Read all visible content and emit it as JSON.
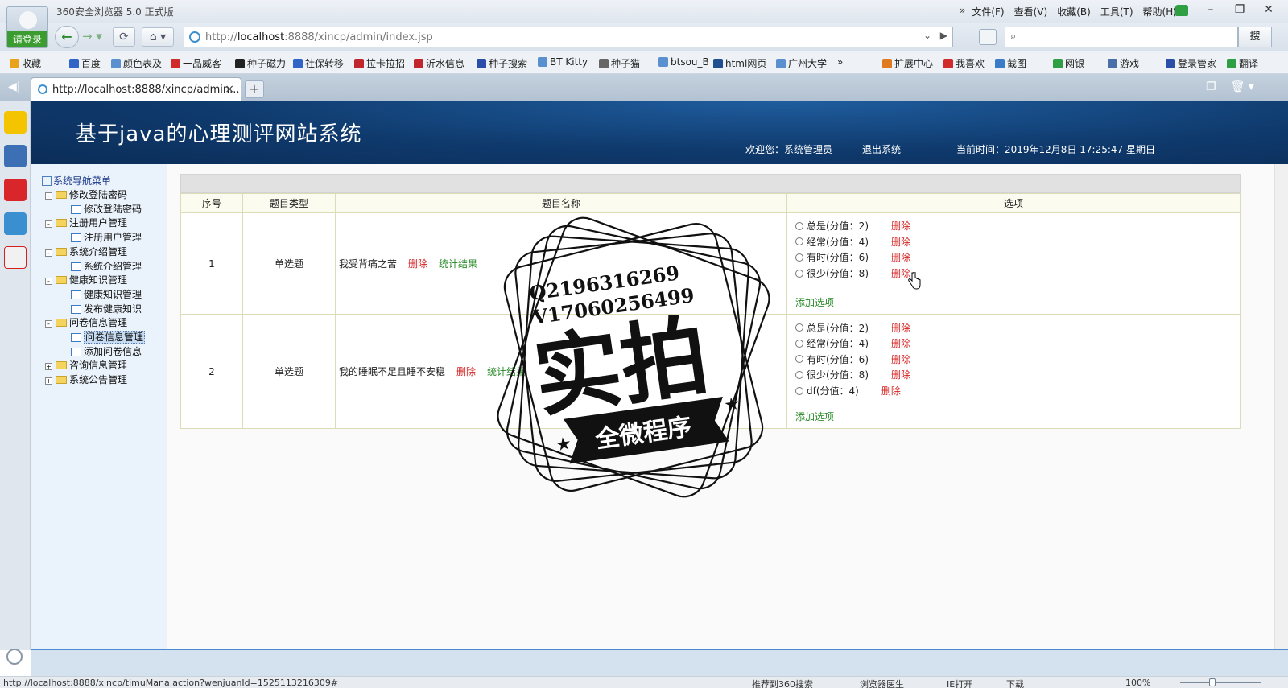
{
  "browser": {
    "app_title": "360安全浏览器 5.0 正式版",
    "login_label": "请登录",
    "menu": [
      "»",
      "文件(F)",
      "查看(V)",
      "收藏(B)",
      "工具(T)",
      "帮助(H)"
    ],
    "url_prefix": "http://",
    "url_host": "localhost",
    "url_rest": ":8888/xincp/admin/index.jsp",
    "search_placeholder": "",
    "search_button": "搜",
    "bookmarks_left": [
      {
        "label": "收藏",
        "color": "#e8a21c"
      },
      {
        "label": "百度",
        "color": "#3064c6"
      },
      {
        "label": "颜色表及",
        "color": "#5a8fd0"
      },
      {
        "label": "一品威客",
        "color": "#d12a2a"
      },
      {
        "label": "种子磁力",
        "color": "#222222"
      },
      {
        "label": "社保转移",
        "color": "#3064c6"
      },
      {
        "label": "拉卡拉招",
        "color": "#c0262b"
      },
      {
        "label": "沂水信息",
        "color": "#c0262b"
      },
      {
        "label": "种子搜索",
        "color": "#2b4fa8"
      },
      {
        "label": "BT Kitty",
        "color": "#5a8fd0"
      },
      {
        "label": "种子猫-",
        "color": "#666666"
      },
      {
        "label": "btsou_B",
        "color": "#5a8fd0"
      },
      {
        "label": "html网页",
        "color": "#1f4f8f"
      },
      {
        "label": "广州大学",
        "color": "#5a8fd0"
      }
    ],
    "bookmarks_more": "»",
    "bookmarks_right": [
      {
        "label": "扩展中心",
        "color": "#e07a1f"
      },
      {
        "label": "我喜欢",
        "color": "#d12a2a"
      },
      {
        "label": "截图",
        "color": "#3a7bc8"
      },
      {
        "label": "网银",
        "color": "#2ea043"
      },
      {
        "label": "游戏",
        "color": "#4a6fa8"
      },
      {
        "label": "登录管家",
        "color": "#2b4fa8"
      },
      {
        "label": "翻译",
        "color": "#2ea043"
      }
    ],
    "tab_title": "http://localhost:8888/xincp/admin...",
    "tab_close": "×",
    "new_tab": "+",
    "status_url": "http://localhost:8888/xincp/timuMana.action?wenjuanId=1525113216309#",
    "status_items": [
      "推荐到360搜索",
      "浏览器医生",
      "IE打开",
      "下载",
      "100%"
    ]
  },
  "page": {
    "title": "基于java的心理测评网站系统",
    "welcome": "欢迎您：系统管理员",
    "logout": "退出系统",
    "time": "当前时间：2019年12月8日 17:25:47 星期日"
  },
  "tree": {
    "root": "系统导航菜单",
    "nodes": [
      {
        "label": "修改登陆密码",
        "type": "folder",
        "open": "-"
      },
      {
        "label": "修改登陆密码",
        "type": "page"
      },
      {
        "label": "注册用户管理",
        "type": "folder",
        "open": "-"
      },
      {
        "label": "注册用户管理",
        "type": "page"
      },
      {
        "label": "系统介绍管理",
        "type": "folder",
        "open": "-"
      },
      {
        "label": "系统介绍管理",
        "type": "page"
      },
      {
        "label": "健康知识管理",
        "type": "folder",
        "open": "-"
      },
      {
        "label": "健康知识管理",
        "type": "page"
      },
      {
        "label": "发布健康知识",
        "type": "page"
      },
      {
        "label": "问卷信息管理",
        "type": "folder",
        "open": "-"
      },
      {
        "label": "问卷信息管理",
        "type": "page",
        "selected": true
      },
      {
        "label": "添加问卷信息",
        "type": "page"
      },
      {
        "label": "咨询信息管理",
        "type": "folder",
        "open": "+"
      },
      {
        "label": "系统公告管理",
        "type": "folder",
        "open": "+"
      }
    ]
  },
  "table": {
    "headers": [
      "序号",
      "题目类型",
      "题目名称",
      "选项"
    ],
    "delete_label": "删除",
    "stats_label": "统计结果",
    "add_option_label": "添加选项",
    "rows": [
      {
        "index": "1",
        "type": "单选题",
        "name": "我受背痛之苦",
        "options": [
          "总是(分值：2)",
          "经常(分值：4)",
          "有时(分值：6)",
          "很少(分值：8)"
        ]
      },
      {
        "index": "2",
        "type": "单选题",
        "name": "我的睡眠不足且睡不安稳",
        "options": [
          "总是(分值：2)",
          "经常(分值：4)",
          "有时(分值：6)",
          "很少(分值：8)",
          "df(分值：4)"
        ]
      }
    ]
  },
  "watermark": {
    "line1": "Q2196316269",
    "line2": "V17060256499",
    "big": "实拍",
    "ribbon": "全微程序"
  }
}
